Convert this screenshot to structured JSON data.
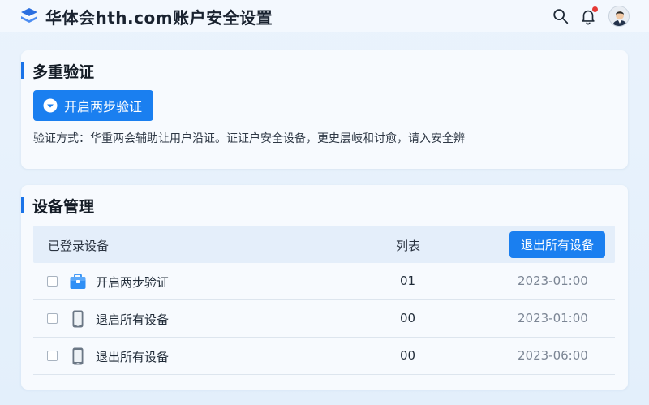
{
  "header": {
    "title": "华体会hth.com账户安全设置",
    "icons": {
      "logo": "logo-icon",
      "search": "search-icon",
      "bell": "bell-icon",
      "avatar": "user-avatar"
    }
  },
  "two_factor": {
    "section_title": "多重验证",
    "button_label": "开启两步验证",
    "button_icon": "chevron-down-circle-icon",
    "description": "验证方式：华重两会辅助让用户沿证。证证户安全设备，更史层岐和讨愈，请入安全辨"
  },
  "devices": {
    "section_title": "设备管理",
    "columns": {
      "device": "已登录设备",
      "list": "列表"
    },
    "logout_all_label": "退出所有设备",
    "rows": [
      {
        "icon": "briefcase-icon",
        "name": "开启两步验证",
        "count": "01",
        "date": "2023-01:00"
      },
      {
        "icon": "phone-icon",
        "name": "退启所有设备",
        "count": "00",
        "date": "2023-01:00"
      },
      {
        "icon": "phone-icon",
        "name": "退出所有设备",
        "count": "00",
        "date": "2023-06:00"
      }
    ]
  },
  "colors": {
    "accent": "#1a7ff0",
    "title_bar": "#1a73e8",
    "notification": "#e53935"
  }
}
